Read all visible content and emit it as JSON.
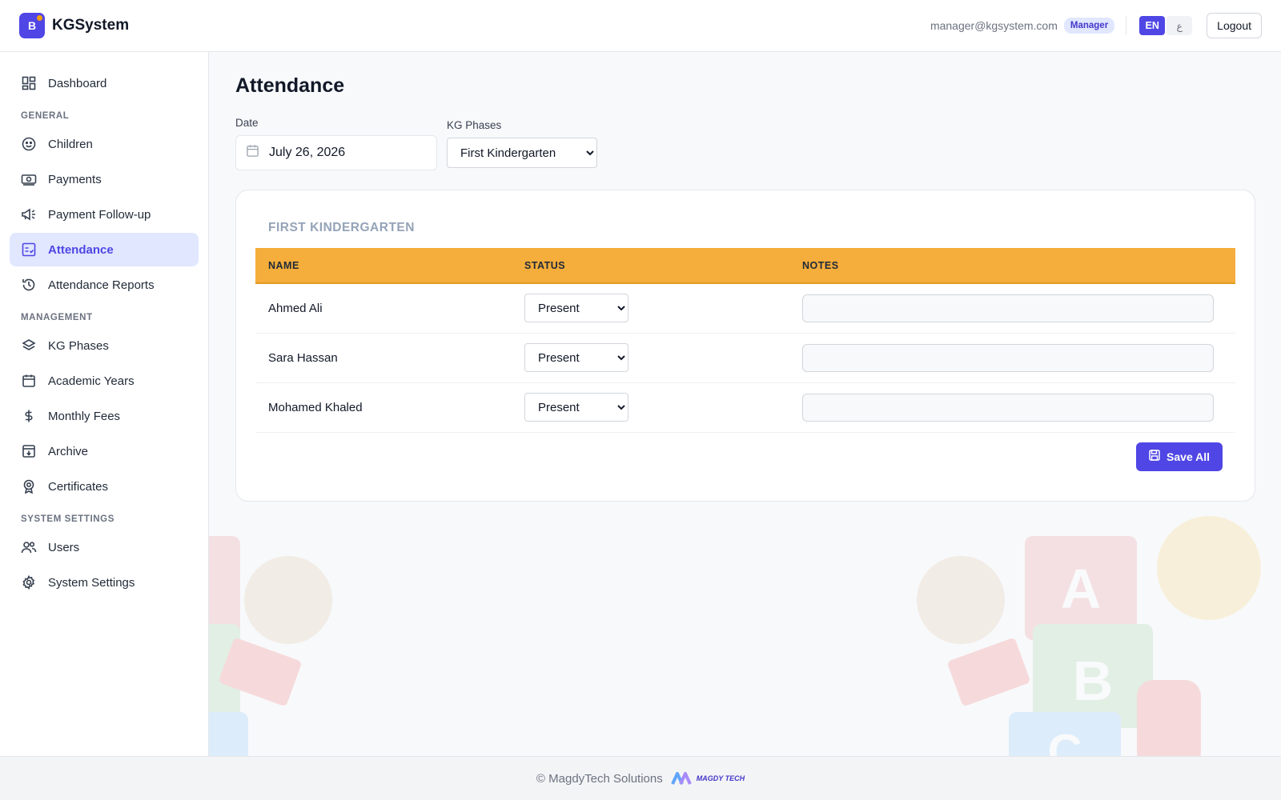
{
  "header": {
    "brand_letter": "B",
    "brand_name": "KGSystem",
    "user_email": "manager@kgsystem.com",
    "role": "Manager",
    "lang_en": "EN",
    "lang_ar": "ع",
    "logout_label": "Logout"
  },
  "sidebar": {
    "dashboard": {
      "label": "Dashboard",
      "icon": "dashboard-icon"
    },
    "sections": {
      "general": "GENERAL",
      "management": "MANAGEMENT",
      "system": "SYSTEM SETTINGS"
    },
    "items": {
      "children": {
        "label": "Children",
        "icon": "smiley-icon"
      },
      "payments": {
        "label": "Payments",
        "icon": "cash-icon"
      },
      "payment_followup": {
        "label": "Payment Follow-up",
        "icon": "megaphone-icon"
      },
      "attendance": {
        "label": "Attendance",
        "icon": "attendance-icon",
        "active": true
      },
      "attendance_reports": {
        "label": "Attendance Reports",
        "icon": "history-icon"
      },
      "kg_phases": {
        "label": "KG Phases",
        "icon": "layers-icon"
      },
      "academic_years": {
        "label": "Academic Years",
        "icon": "calendar-icon"
      },
      "monthly_fees": {
        "label": "Monthly Fees",
        "icon": "dollar-icon"
      },
      "archive": {
        "label": "Archive",
        "icon": "archive-icon"
      },
      "certificates": {
        "label": "Certificates",
        "icon": "award-icon"
      },
      "users": {
        "label": "Users",
        "icon": "users-icon"
      },
      "system_settings": {
        "label": "System Settings",
        "icon": "gear-icon"
      }
    }
  },
  "main": {
    "title": "Attendance",
    "date_label": "Date",
    "date_value": "July 26, 2026",
    "phase_label": "KG Phases",
    "phase_selected": "First Kindergarten",
    "card_title": "FIRST KINDERGARTEN",
    "columns": {
      "name": "NAME",
      "status": "STATUS",
      "notes": "NOTES"
    },
    "rows": [
      {
        "name": "Ahmed Ali",
        "status": "Present",
        "notes": ""
      },
      {
        "name": "Sara Hassan",
        "status": "Present",
        "notes": ""
      },
      {
        "name": "Mohamed Khaled",
        "status": "Present",
        "notes": ""
      }
    ],
    "save_label": "Save All"
  },
  "footer": {
    "copyright": "© MagdyTech Solutions",
    "logo_text": "MAGDY TECH"
  },
  "colors": {
    "accent": "#4f46e5",
    "table_header": "#f5ad3b",
    "active_nav_bg": "#e0e7ff"
  }
}
